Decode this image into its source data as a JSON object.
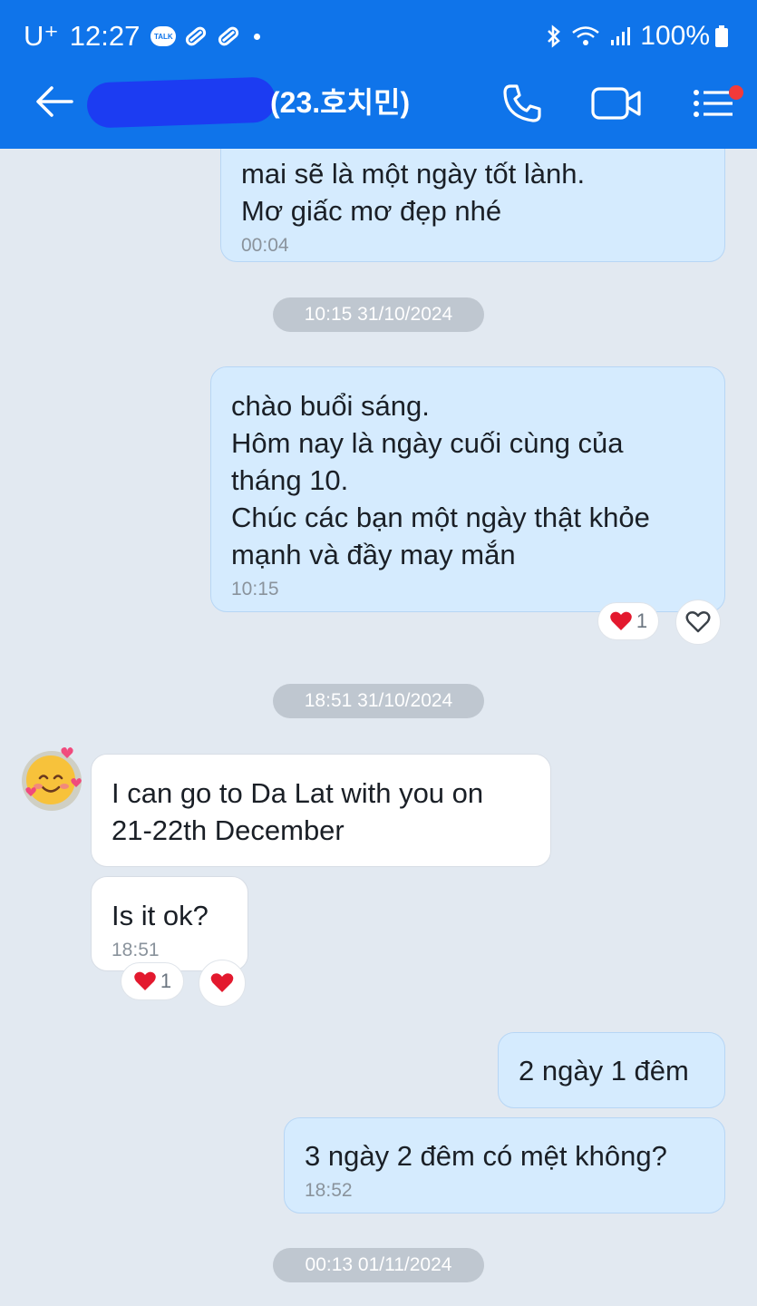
{
  "status_bar": {
    "carrier": "U⁺",
    "time": "12:27",
    "talk_badge": "TALK",
    "battery": "100%"
  },
  "header": {
    "title": "(23.호치민)"
  },
  "colors": {
    "header_bg": "#0f74ea",
    "chat_bg": "#e2e9f1",
    "my_bubble": "#d5ebfe",
    "their_bubble": "#ffffff",
    "date_pill": "#bfc7d0",
    "notification_dot": "#f23a3a"
  },
  "messages": [
    {
      "from": "me",
      "lines": [
        "mai sẽ là một ngày tốt lành.",
        "Mơ giấc mơ đẹp nhé"
      ],
      "time": "00:04"
    },
    {
      "from": "me",
      "lines": [
        "chào buổi sáng.",
        "Hôm nay là ngày cuối cùng của",
        "tháng 10.",
        "Chúc các bạn một ngày thật khỏe",
        "mạnh và đầy may mắn"
      ],
      "time": "10:15",
      "reaction_count": "1"
    },
    {
      "from": "them",
      "lines": [
        "I can go to Da Lat with you on",
        "21-22th December"
      ]
    },
    {
      "from": "them",
      "lines": [
        "Is it ok?"
      ],
      "time": "18:51",
      "reaction_count": "1"
    },
    {
      "from": "me",
      "lines": [
        "2 ngày 1 đêm"
      ]
    },
    {
      "from": "me",
      "lines": [
        "3 ngày 2 đêm có mệt không?"
      ],
      "time": "18:52"
    }
  ],
  "date_separators": [
    "10:15 31/10/2024",
    "18:51 31/10/2024",
    "00:13 01/11/2024"
  ],
  "icons": {
    "back": "arrow-left-icon",
    "call": "phone-icon",
    "video": "video-camera-icon",
    "menu": "menu-icon",
    "reaction": "red-heart-icon",
    "add_reaction": "heart-outline-icon",
    "avatar": "smiling-face-with-hearts-emoji"
  }
}
